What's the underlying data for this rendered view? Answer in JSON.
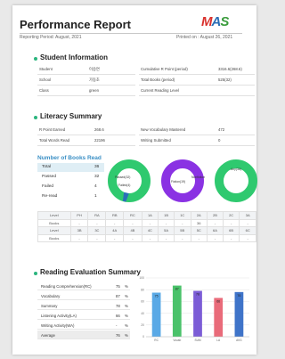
{
  "report": {
    "title": "Performance Report",
    "period": "Reporting Period: August, 2021",
    "printed": "Printed on : August 26, 2021"
  },
  "logo": {
    "m": "M",
    "a": "A",
    "s": "S"
  },
  "student_info": {
    "heading": "Student Information",
    "left": [
      {
        "label": "Student",
        "value": "이승연"
      },
      {
        "label": "School",
        "value": "가동초"
      },
      {
        "label": "Class",
        "value": "green"
      }
    ],
    "right": [
      {
        "label": "Cumulative R Point (period)",
        "value": "3316.6(268.6)"
      },
      {
        "label": "Total Books (period)",
        "value": "525(32)"
      },
      {
        "label": "Current Reading Level",
        "value": ""
      }
    ]
  },
  "literacy": {
    "heading": "Literacy Summary",
    "left": [
      {
        "label": "R Point Earned",
        "value": "268.6"
      },
      {
        "label": "Total Words Read",
        "value": "22196"
      }
    ],
    "right": [
      {
        "label": "New Vocabulary Mastered",
        "value": "472"
      },
      {
        "label": "Writing Submitted",
        "value": "0"
      }
    ]
  },
  "books_read": {
    "title": "Number of Books Read",
    "rows": [
      {
        "label": "Total",
        "value": "36"
      },
      {
        "label": "Passed",
        "value": "32"
      },
      {
        "label": "Failed",
        "value": "4"
      },
      {
        "label": "Re-read",
        "value": "1"
      }
    ]
  },
  "donuts": [
    {
      "segments": [
        {
          "label": "Passed(32)",
          "value": 32,
          "color": "#2fc96f"
        },
        {
          "label": "Failed(4)",
          "value": 4,
          "color": "#2a6fb8"
        }
      ]
    },
    {
      "segments": [
        {
          "label": "Fiction(19)",
          "value": 19,
          "color": "#8a32e3"
        },
        {
          "label": "Nonfiction",
          "value": 17,
          "color": "#8a32e3"
        }
      ]
    },
    {
      "segments": [
        {
          "label": "Any(36)",
          "value": 36,
          "color": "#2fc96f"
        }
      ]
    }
  ],
  "level_table": {
    "rows": [
      [
        "Level",
        "PH",
        "RA",
        "RB",
        "RC",
        "1A",
        "1B",
        "1C",
        "2A",
        "2B",
        "2C",
        "3A"
      ],
      [
        "Books",
        "-",
        "-",
        "-",
        "-",
        "-",
        "-",
        "-",
        "36",
        "-",
        "-",
        "-"
      ],
      [
        "Level",
        "3B",
        "3C",
        "4A",
        "4B",
        "4C",
        "5A",
        "5B",
        "5C",
        "6A",
        "6B",
        "6C"
      ],
      [
        "Books",
        "-",
        "-",
        "-",
        "-",
        "-",
        "-",
        "-",
        "-",
        "-",
        "-",
        "-"
      ]
    ]
  },
  "reading_eval": {
    "heading": "Reading Evaluation Summary",
    "rows": [
      {
        "label": "Reading Comprehension(RC)",
        "value": "75",
        "unit": "%"
      },
      {
        "label": "Vocabulary",
        "value": "87",
        "unit": "%"
      },
      {
        "label": "Summary",
        "value": "78",
        "unit": "%"
      },
      {
        "label": "Listening Activity(LA)",
        "value": "66",
        "unit": "%"
      },
      {
        "label": "Writing Activity(WA)",
        "value": "-",
        "unit": "%"
      },
      {
        "label": "Average",
        "value": "76",
        "unit": "%"
      }
    ]
  },
  "chart_data": {
    "type": "bar",
    "categories": [
      "RC",
      "Vocab",
      "SUM",
      "LA",
      "AVG"
    ],
    "values": [
      75,
      87,
      78,
      66,
      76
    ],
    "colors": [
      "#5aa9e6",
      "#4ac26a",
      "#7b5cd6",
      "#e96b7a",
      "#3f74c9"
    ],
    "ylim": [
      0,
      100
    ],
    "yticks": [
      0,
      20,
      40,
      60,
      80,
      100
    ],
    "grid": true
  }
}
